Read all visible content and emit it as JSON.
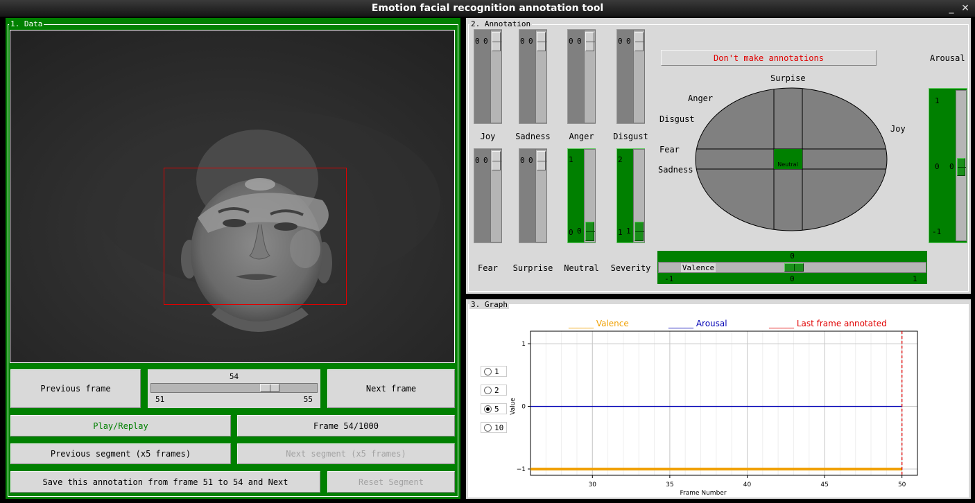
{
  "window": {
    "title": "Emotion facial recognition annotation tool"
  },
  "data_panel": {
    "legend": "1. Data",
    "frame_slider": {
      "value": "54",
      "min": "51",
      "max": "55",
      "value_fraction": 0.75
    },
    "buttons": {
      "previous_frame": "Previous frame",
      "next_frame": "Next frame",
      "play_replay": "Play/Replay",
      "frame_counter": "Frame 54/1000",
      "previous_segment": "Previous segment (x5 frames)",
      "next_segment": "Next segment (x5 frames)",
      "save_annotation": "Save this annotation from frame 51 to 54 and Next",
      "reset_segment": "Reset Segment"
    }
  },
  "annotation_panel": {
    "legend": "2. Annotation",
    "dont_annotate_button": "Don't make annotations",
    "emotion_sliders": [
      {
        "label": "Joy",
        "top_value": "0",
        "bottom_value": "",
        "thumb_value": "0",
        "active": false
      },
      {
        "label": "Sadness",
        "top_value": "0",
        "bottom_value": "",
        "thumb_value": "0",
        "active": false
      },
      {
        "label": "Anger",
        "top_value": "0",
        "bottom_value": "",
        "thumb_value": "0",
        "active": false
      },
      {
        "label": "Disgust",
        "top_value": "0",
        "bottom_value": "",
        "thumb_value": "0",
        "active": false
      },
      {
        "label": "Fear",
        "top_value": "0",
        "bottom_value": "",
        "thumb_value": "0",
        "active": false
      },
      {
        "label": "Surprise",
        "top_value": "0",
        "bottom_value": "",
        "thumb_value": "0",
        "active": false
      },
      {
        "label": "Neutral",
        "top_value": "1",
        "bottom_value": "0",
        "thumb_value": "0",
        "active": true
      },
      {
        "label": "Severity",
        "top_value": "2",
        "bottom_value": "1",
        "thumb_value": "1",
        "active": true
      }
    ],
    "wheel": {
      "top": "Surpise",
      "anger": "Anger",
      "disgust": "Disgust",
      "joy": "Joy",
      "fear": "Fear",
      "sadness": "Sadness",
      "center": "Neutral"
    },
    "arousal": {
      "label": "Arousal",
      "max": "1",
      "value": "0",
      "min": "-1"
    },
    "valence": {
      "label": "Valence",
      "value": "0",
      "min": "-1",
      "mid": "0",
      "max": "1"
    }
  },
  "graph_panel": {
    "legend": "3. Graph",
    "radio_options": [
      {
        "label": "1",
        "selected": false
      },
      {
        "label": "2",
        "selected": false
      },
      {
        "label": "5",
        "selected": true
      },
      {
        "label": "10",
        "selected": false
      }
    ],
    "chart_data": {
      "type": "line",
      "xlabel": "Frame Number",
      "ylabel": "Value",
      "xlim": [
        26,
        51
      ],
      "ylim": [
        -1.1,
        1.2
      ],
      "x_ticks": [
        30,
        35,
        40,
        45,
        50
      ],
      "y_ticks": [
        -1,
        0,
        1
      ],
      "legend_position": "top",
      "series": [
        {
          "name": "Valence",
          "legend_text": "______ Valence",
          "color": "#f0a000",
          "x": [
            26,
            50
          ],
          "y": [
            -1,
            -1
          ]
        },
        {
          "name": "Arousal",
          "legend_text": "______ Arousal",
          "color": "#0000b4",
          "x": [
            26,
            50
          ],
          "y": [
            0,
            0
          ]
        }
      ],
      "last_frame_annotated": {
        "name": "Last frame annotated",
        "legend_text": "______ Last frame annotated",
        "color": "#e00000",
        "x": 50
      }
    }
  }
}
